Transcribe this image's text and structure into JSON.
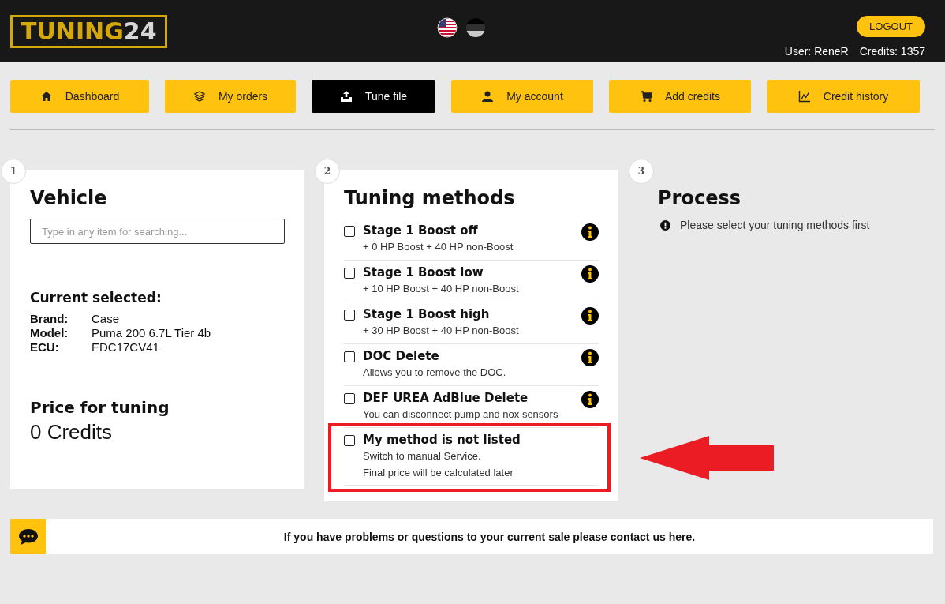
{
  "header": {
    "logo": {
      "primary": "TUNING",
      "secondary": "24"
    },
    "languages": [
      {
        "kind": "us",
        "selected": true
      },
      {
        "kind": "de",
        "selected": false
      }
    ],
    "logout": "LOGOUT",
    "user": "User: ReneR",
    "credits": "Credits: 1357"
  },
  "nav": [
    {
      "label": "Dashboard",
      "kind": "home",
      "selected": false
    },
    {
      "label": "My orders",
      "kind": "layers",
      "selected": false
    },
    {
      "label": "Tune file",
      "kind": "upload",
      "selected": true
    },
    {
      "label": "My account",
      "kind": "user",
      "selected": false
    },
    {
      "label": "Add credits",
      "kind": "cart",
      "selected": false
    },
    {
      "label": "Credit history",
      "kind": "chart",
      "selected": false
    }
  ],
  "vehicle": {
    "step": "1",
    "title": "Vehicle",
    "search": {
      "placeholder": "Type in any item for searching..."
    },
    "current_title": "Current selected:",
    "fields": [
      {
        "label": "Brand:",
        "value": "Case"
      },
      {
        "label": "Model:",
        "value": "Puma 200 6.7L Tier 4b"
      },
      {
        "label": "ECU:",
        "value": "EDC17CV41"
      }
    ],
    "price_title": "Price for tuning",
    "price": "0 Credits"
  },
  "methods": {
    "step": "2",
    "title": "Tuning methods",
    "items": [
      {
        "name": "Stage 1 Boost off",
        "lines": [
          "+ 0 HP Boost + 40 HP non-Boost"
        ],
        "checked": false,
        "info": true,
        "highlighted": false
      },
      {
        "name": "Stage 1 Boost low",
        "lines": [
          "+ 10 HP Boost + 40 HP non-Boost"
        ],
        "checked": false,
        "info": true,
        "highlighted": false
      },
      {
        "name": "Stage 1 Boost high",
        "lines": [
          "+ 30 HP Boost + 40 HP non-Boost"
        ],
        "checked": false,
        "info": true,
        "highlighted": false
      },
      {
        "name": "DOC Delete",
        "lines": [
          "Allows you to remove the DOC."
        ],
        "checked": false,
        "info": true,
        "highlighted": false
      },
      {
        "name": "DEF UREA AdBlue Delete",
        "lines": [
          "You can disconnect pump and nox sensors"
        ],
        "checked": false,
        "info": true,
        "highlighted": false
      },
      {
        "name": "My method is not listed",
        "lines": [
          "Switch to manual Service.",
          "Final price will be calculated later"
        ],
        "checked": false,
        "info": false,
        "highlighted": true
      }
    ]
  },
  "process": {
    "step": "3",
    "title": "Process",
    "message": "Please select your tuning methods first"
  },
  "contact": "If you have problems or questions to your current sale please contact us here."
}
